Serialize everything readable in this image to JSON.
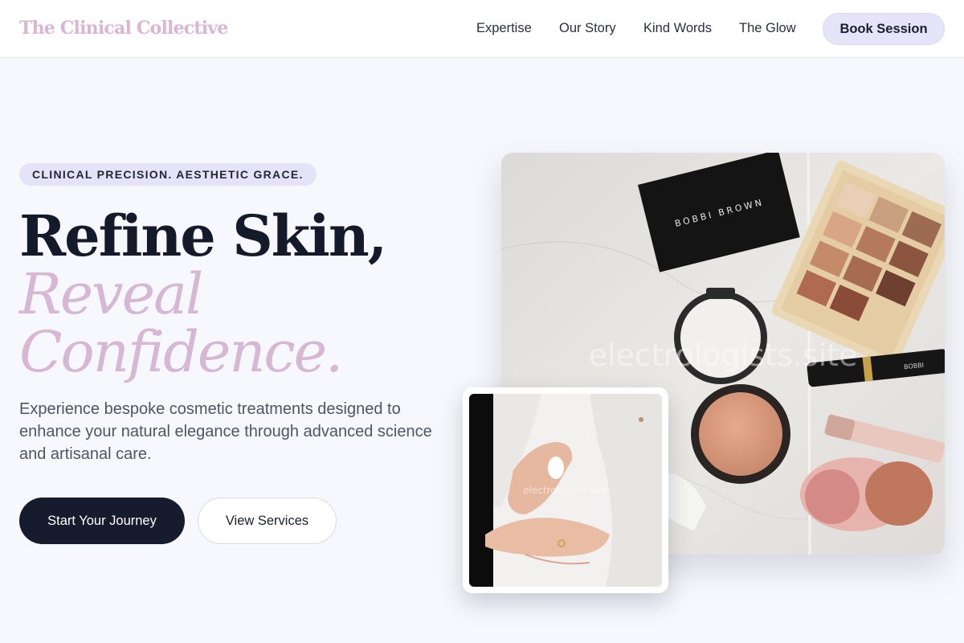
{
  "header": {
    "logo": "The Clinical Collective",
    "nav": [
      "Expertise",
      "Our Story",
      "Kind Words",
      "The Glow"
    ],
    "cta": "Book Session"
  },
  "hero": {
    "tagline": "CLINICAL PRECISION. AESTHETIC GRACE.",
    "headline_line1": "Refine Skin,",
    "headline_line2": "Reveal",
    "headline_line3": "Confidence.",
    "subcopy": "Experience bespoke cosmetic treatments designed to enhance your natural elegance through advanced science and artisanal care.",
    "primary_button": "Start Your Journey",
    "secondary_button": "View Services",
    "main_image": {
      "brand_text": "BOBBI BROWN",
      "watermark": "electrologists.site"
    },
    "inset_image": {
      "watermark": "electrologists.site"
    }
  },
  "colors": {
    "accent_pink": "#d6b7d4",
    "navy": "#161b2e",
    "lavender": "#e5e4f8",
    "page_bg": "#f7f8fd"
  }
}
